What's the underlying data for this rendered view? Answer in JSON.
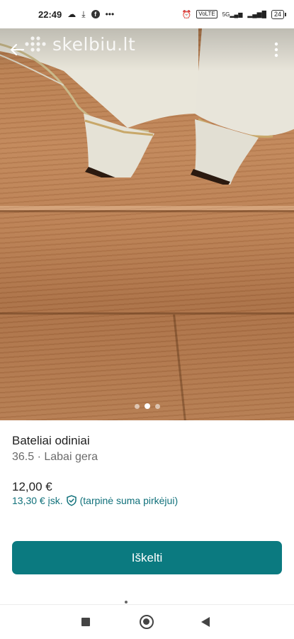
{
  "status_bar": {
    "time": "22:49",
    "left_icons": [
      "cloud-icon",
      "download-icon",
      "facebook-icon",
      "more-dots-icon"
    ],
    "right_icons": [
      "alarm-icon",
      "volte-icon",
      "signal-5g-icon",
      "signal-bars-icon"
    ],
    "volte_label": "VoLTE",
    "network_label": "5G",
    "battery": "24"
  },
  "header": {
    "logo_text": "skelbiu.lt",
    "back_icon": "arrow-left-icon",
    "menu_icon": "more-vertical-icon"
  },
  "gallery": {
    "image_count": 3,
    "active_index": 1
  },
  "listing": {
    "title": "Bateliai odiniai",
    "subtitle": "36.5 · Labai gera",
    "price": "12,00 €",
    "price_incl": "13,30 € įsk.",
    "protection_note": "(tarpinė suma pirkėjui)"
  },
  "actions": {
    "cta_label": "Iškelti"
  },
  "colors": {
    "accent": "#0b7a80",
    "accent_text": "#11717b"
  }
}
